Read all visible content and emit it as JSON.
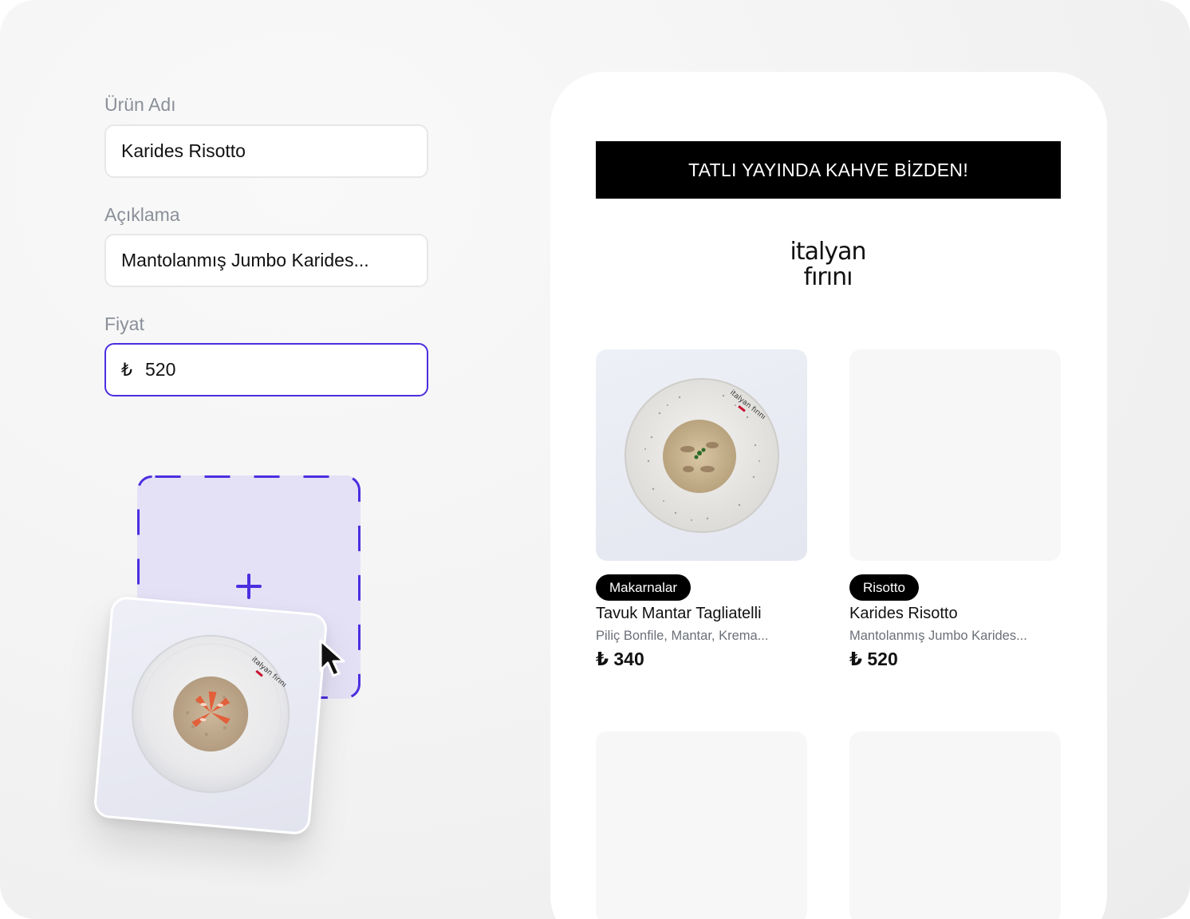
{
  "form": {
    "name_label": "Ürün Adı",
    "name_value": "Karides Risotto",
    "desc_label": "Açıklama",
    "desc_value": "Mantolanmış Jumbo Karides...",
    "price_label": "Fiyat",
    "price_currency": "₺",
    "price_value": "520"
  },
  "upload": {
    "icon": "plus-icon",
    "cursor": "arrow-cursor-icon",
    "accent": "#4b2ee0"
  },
  "menu": {
    "banner": "TATLI YAYINDA KAHVE BİZDEN!",
    "logo_line1": "italyan",
    "logo_line2": "fırını",
    "items": [
      {
        "category": "Makarnalar",
        "title": "Tavuk Mantar Tagliatelli",
        "desc": "Piliç Bonfile, Mantar, Krema...",
        "price": "₺ 340"
      },
      {
        "category": "Risotto",
        "title": "Karides Risotto",
        "desc": "Mantolanmış Jumbo Karides...",
        "price": "₺ 520"
      }
    ]
  }
}
